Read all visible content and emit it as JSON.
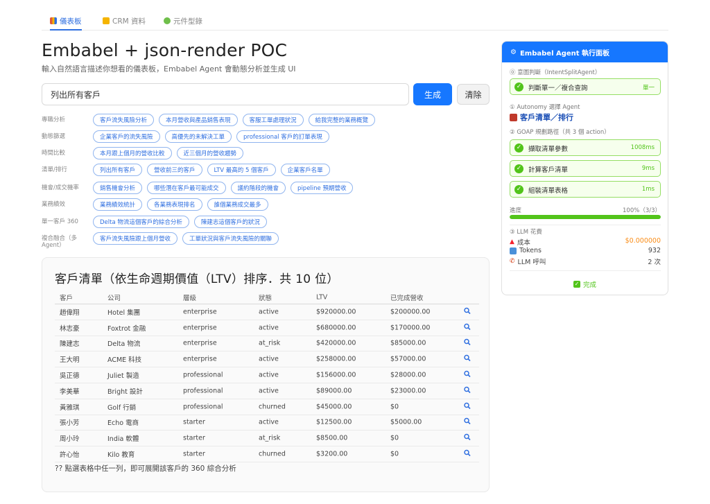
{
  "tabs": [
    {
      "label": "儀表板",
      "icon": "chart-icon",
      "active": true
    },
    {
      "label": "CRM 資料",
      "icon": "folder-icon",
      "active": false
    },
    {
      "label": "元件型錄",
      "icon": "puzzle-icon",
      "active": false
    }
  ],
  "header": {
    "title": "Embabel + json-render POC",
    "subtitle": "輸入自然語言描述你想看的儀表板，Embabel Agent 會動態分析並生成 UI"
  },
  "prompt": {
    "value": "列出所有客戶",
    "generate_label": "生成",
    "clear_label": "清除"
  },
  "suggestions": [
    {
      "category": "專職分析",
      "chips": [
        "客戶流失風險分析",
        "本月營收與產品銷售表現",
        "客服工單處理狀況",
        "給我完整的業務概覽"
      ]
    },
    {
      "category": "動態篩選",
      "chips": [
        "企業客戶的流失風險",
        "高優先的未解決工單",
        "professional 客戶的訂單表現"
      ]
    },
    {
      "category": "時間比較",
      "chips": [
        "本月跟上個月的營收比較",
        "近三個月的營收趨勢"
      ]
    },
    {
      "category": "清單/排行",
      "chips": [
        "列出所有客戶",
        "營收前三的客戶",
        "LTV 最高的 5 個客戶",
        "企業客戶名單"
      ]
    },
    {
      "category": "機會/成交機率",
      "chips": [
        "銷售機會分析",
        "哪些潛在客戶最可能成交",
        "議約階段的機會",
        "pipeline 預期營收"
      ]
    },
    {
      "category": "業務績效",
      "chips": [
        "業務績效統計",
        "各業務表現排名",
        "誰個業務成交最多"
      ]
    },
    {
      "category": "單一客戶 360",
      "chips": [
        "Delta 物流這個客戶的綜合分析",
        "陳建志這個客戶的狀況"
      ]
    },
    {
      "category": "複合融合（多 Agent）",
      "chips": [
        "客戶流失風險跟上個月營收",
        "工單狀況與客戶流失風險的關聯"
      ]
    }
  ],
  "result": {
    "title": "客戶清單（依生命週期價值（LTV）排序．共 10 位）",
    "columns": [
      "客戶",
      "公司",
      "層級",
      "狀態",
      "LTV",
      "已完成營收"
    ],
    "rows": [
      [
        "趙偉翔",
        "Hotel 集團",
        "enterprise",
        "active",
        "$920000.00",
        "$200000.00"
      ],
      [
        "林志豪",
        "Foxtrot 金融",
        "enterprise",
        "active",
        "$680000.00",
        "$170000.00"
      ],
      [
        "陳建志",
        "Delta 物流",
        "enterprise",
        "at_risk",
        "$420000.00",
        "$85000.00"
      ],
      [
        "王大明",
        "ACME 科技",
        "enterprise",
        "active",
        "$258000.00",
        "$57000.00"
      ],
      [
        "吳正德",
        "Juliet 製造",
        "professional",
        "active",
        "$156000.00",
        "$28000.00"
      ],
      [
        "李美華",
        "Bright 設計",
        "professional",
        "active",
        "$89000.00",
        "$23000.00"
      ],
      [
        "黃雅琪",
        "Golf 行銷",
        "professional",
        "churned",
        "$45000.00",
        "$0"
      ],
      [
        "張小芳",
        "Echo 電商",
        "starter",
        "active",
        "$12500.00",
        "$5000.00"
      ],
      [
        "周小玲",
        "India 軟體",
        "starter",
        "at_risk",
        "$8500.00",
        "$0"
      ],
      [
        "許心怡",
        "Kilo 教育",
        "starter",
        "churned",
        "$3200.00",
        "$0"
      ]
    ],
    "row_icon": "magnifier-icon",
    "note": "?? 點選表格中任一列，即可展開該客戶的 360 綜合分析"
  },
  "panel": {
    "title": "Embabel Agent 執行面板",
    "intent_label": "⓪ 意圖判斷（IntentSplitAgent）",
    "intent_step": {
      "label": "判斷單一／複合查詢",
      "value": "單一"
    },
    "autonomy_label": "① Autonomy 選擇 Agent",
    "agent_selected": "客戶清單／排行",
    "goap_label": "② GOAP 規劃路徑（共 3 個 action）",
    "steps": [
      {
        "label": "擷取清單參數",
        "value": "1008ms"
      },
      {
        "label": "計算客戶清單",
        "value": "9ms"
      },
      {
        "label": "組裝清單表格",
        "value": "1ms"
      }
    ],
    "progress_label": "進度",
    "progress_text": "100%（3/3）",
    "progress_fraction": 1.0,
    "llm_label": "③ LLM 花費",
    "llm": [
      {
        "key": "成本",
        "value": "$0.000000",
        "icon": "fire-icon"
      },
      {
        "key": "Tokens",
        "value": "932",
        "icon": "tokens-icon"
      },
      {
        "key": "LLM 呼叫",
        "value": "2 次",
        "icon": "phone-icon"
      }
    ],
    "done_label": "完成"
  },
  "colors": {
    "primary": "#1677ff",
    "success": "#52c41a",
    "cost": "#fa8c16"
  }
}
